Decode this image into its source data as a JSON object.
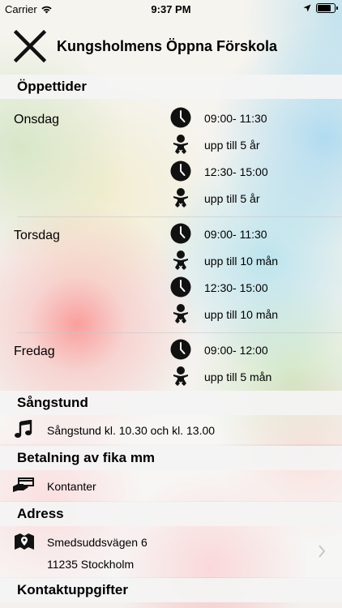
{
  "status_bar": {
    "carrier": "Carrier",
    "time": "9:37 PM"
  },
  "nav": {
    "title": "Kungsholmens Öppna Förskola"
  },
  "sections": {
    "opening": "Öppettider",
    "song": "Sångstund",
    "payment": "Betalning av fika mm",
    "address": "Adress",
    "contact": "Kontaktuppgifter"
  },
  "schedule": [
    {
      "day": "Onsdag",
      "slots": [
        {
          "time": "09:00- 11:30",
          "age": "upp till 5 år"
        },
        {
          "time": "12:30- 15:00",
          "age": "upp till 5 år"
        }
      ]
    },
    {
      "day": "Torsdag",
      "slots": [
        {
          "time": "09:00- 11:30",
          "age": "upp till 10 mån"
        },
        {
          "time": "12:30- 15:00",
          "age": "upp till 10 mån"
        }
      ]
    },
    {
      "day": "Fredag",
      "slots": [
        {
          "time": "09:00- 12:00",
          "age": "upp till 5 mån"
        }
      ]
    }
  ],
  "song": {
    "text": "Sångstund kl. 10.30 och kl. 13.00"
  },
  "payment": {
    "text": "Kontanter"
  },
  "address": {
    "street": "Smedsuddsvägen 6",
    "city": "11235 Stockholm"
  },
  "icons": {
    "clock": "clock-icon",
    "baby": "baby-icon",
    "music": "music-note-icon",
    "payment": "card-payment-icon",
    "map": "map-marker-icon",
    "chevron": "chevron-right-icon"
  }
}
